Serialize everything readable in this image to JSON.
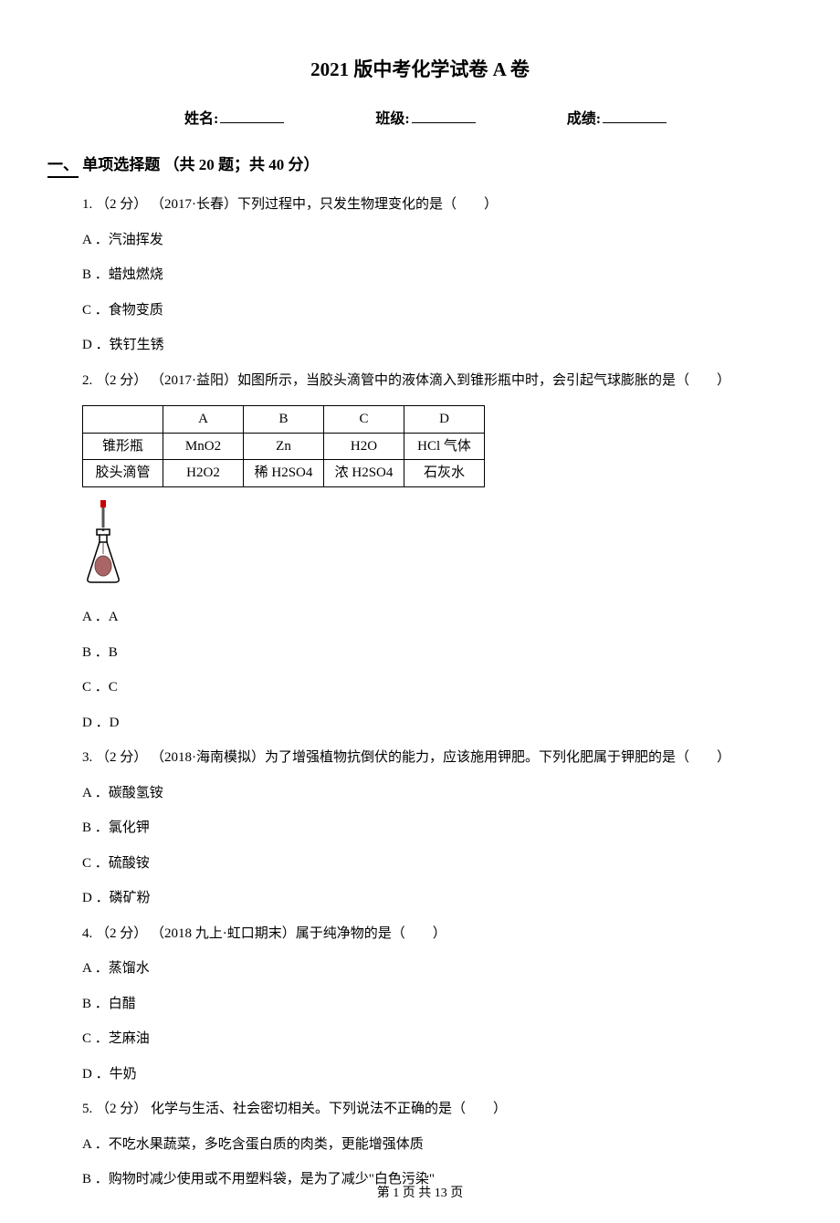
{
  "title": "2021 版中考化学试卷 A 卷",
  "info": {
    "name_label": "姓名:",
    "class_label": "班级:",
    "score_label": "成绩:"
  },
  "section": {
    "num": "一、",
    "title": "单项选择题",
    "meta": "（共 20 题；共 40 分）"
  },
  "q1": {
    "stem": "1. （2 分） （2017·长春）下列过程中，只发生物理变化的是（　　）",
    "a": "A ．汽油挥发",
    "b": "B ．蜡烛燃烧",
    "c": "C ．食物变质",
    "d": "D ．铁钉生锈"
  },
  "q2": {
    "stem": "2. （2 分） （2017·益阳）如图所示，当胶头滴管中的液体滴入到锥形瓶中时，会引起气球膨胀的是（　　）",
    "table": {
      "cols": [
        "A",
        "B",
        "C",
        "D"
      ],
      "row1_label": "锥形瓶",
      "row1": [
        "MnO2",
        "Zn",
        "H2O",
        "HCl 气体"
      ],
      "row2_label": "胶头滴管",
      "row2": [
        "H2O2",
        "稀 H2SO4",
        "浓 H2SO4",
        "石灰水"
      ]
    },
    "a": "A ．A",
    "b": "B ．B",
    "c": "C ．C",
    "d": "D ．D"
  },
  "q3": {
    "stem": "3. （2 分） （2018·海南模拟）为了增强植物抗倒伏的能力，应该施用钾肥。下列化肥属于钾肥的是（　　）",
    "a": "A ．碳酸氢铵",
    "b": "B ．氯化钾",
    "c": "C ．硫酸铵",
    "d": "D ．磷矿粉"
  },
  "q4": {
    "stem": "4. （2 分） （2018 九上·虹口期末）属于纯净物的是（　　）",
    "a": "A ．蒸馏水",
    "b": "B ．白醋",
    "c": "C ．芝麻油",
    "d": "D ．牛奶"
  },
  "q5": {
    "stem": "5. （2 分）  化学与生活、社会密切相关。下列说法不正确的是（　　）",
    "a": "A ．不吃水果蔬菜，多吃含蛋白质的肉类，更能增强体质",
    "b": "B ．购物时减少使用或不用塑料袋，是为了减少\"白色污染\""
  },
  "footer": "第 1 页 共 13 页"
}
